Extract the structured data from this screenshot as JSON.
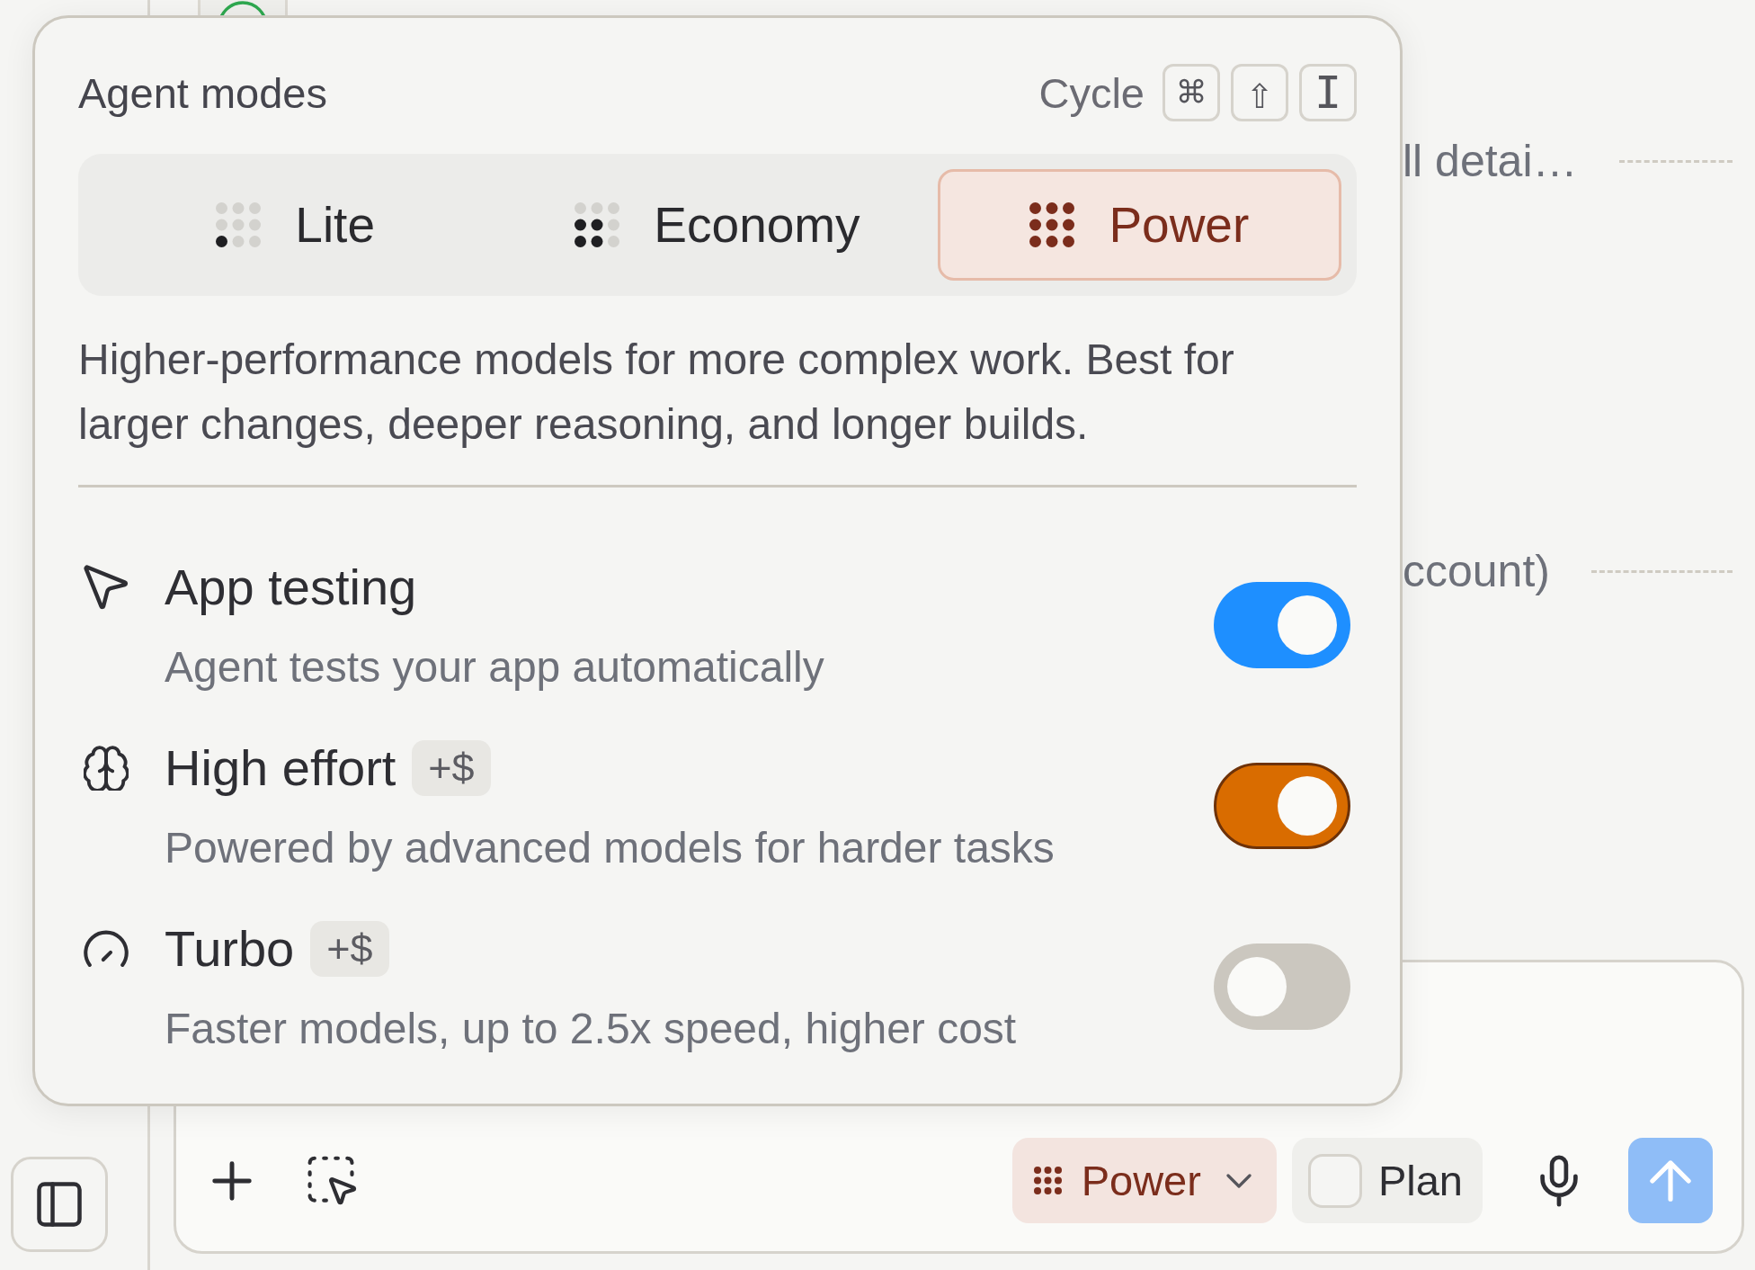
{
  "background_rows": [
    {
      "text": "ll detai…"
    },
    {
      "text": "ccount)"
    }
  ],
  "agent_modes": {
    "title": "Agent modes",
    "cycle_label": "Cycle",
    "shortcut_keys": [
      "⌘",
      "⇧",
      "I"
    ],
    "modes": [
      {
        "label": "Lite",
        "kind": "low",
        "selected": false
      },
      {
        "label": "Economy",
        "kind": "medium",
        "selected": false
      },
      {
        "label": "Power",
        "kind": "high",
        "selected": true
      }
    ],
    "description": "Higher-performance models for more complex work. Best for larger changes, deeper reasoning, and longer builds.",
    "options": [
      {
        "title": "App testing",
        "description": "Agent tests your app automatically",
        "on": true,
        "focused": false,
        "color": "#1e8fff"
      },
      {
        "title": "High effort",
        "badge": "+$",
        "description": "Powered by advanced models for harder tasks",
        "on": true,
        "focused": true,
        "color": "#d96c00"
      },
      {
        "title": "Turbo",
        "badge": "+$",
        "description": "Faster models, up to 2.5x speed, higher cost",
        "on": false,
        "focused": false
      }
    ]
  },
  "composer": {
    "mode_button": {
      "label": "Power",
      "kind": "high"
    },
    "plan_toggle": {
      "label": "Plan",
      "checked": false
    }
  }
}
